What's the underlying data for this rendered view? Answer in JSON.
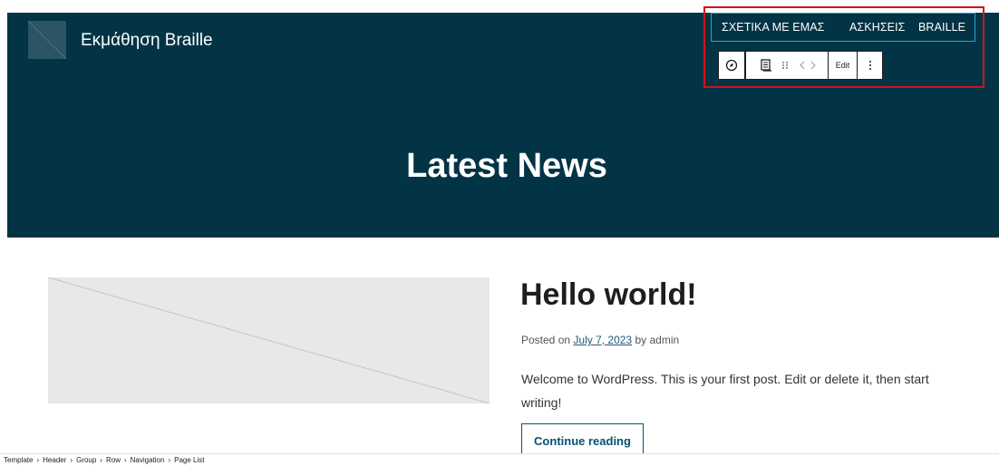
{
  "site": {
    "title": "Εκμάθηση Braille"
  },
  "nav": {
    "items": [
      "ΣΧΕΤΙΚΑ ΜΕ ΕΜΑΣ",
      "ΑΣΚΗΣΕΙΣ",
      "BRAILLE"
    ]
  },
  "toolbar": {
    "edit_label": "Edit"
  },
  "page": {
    "title": "Latest News"
  },
  "post": {
    "title": "Hello world!",
    "meta_prefix": "Posted on",
    "date": "July 7, 2023",
    "meta_by": "by",
    "author": "admin",
    "excerpt": "Welcome to WordPress. This is your first post. Edit or delete it, then start writing!",
    "continue_label": "Continue reading"
  },
  "breadcrumb": [
    "Template",
    "Header",
    "Group",
    "Row",
    "Navigation",
    "Page List"
  ],
  "colors": {
    "hero_bg": "#023446",
    "selection": "#d0141b",
    "nav_border": "#2d9fd9",
    "link": "#26587a"
  }
}
